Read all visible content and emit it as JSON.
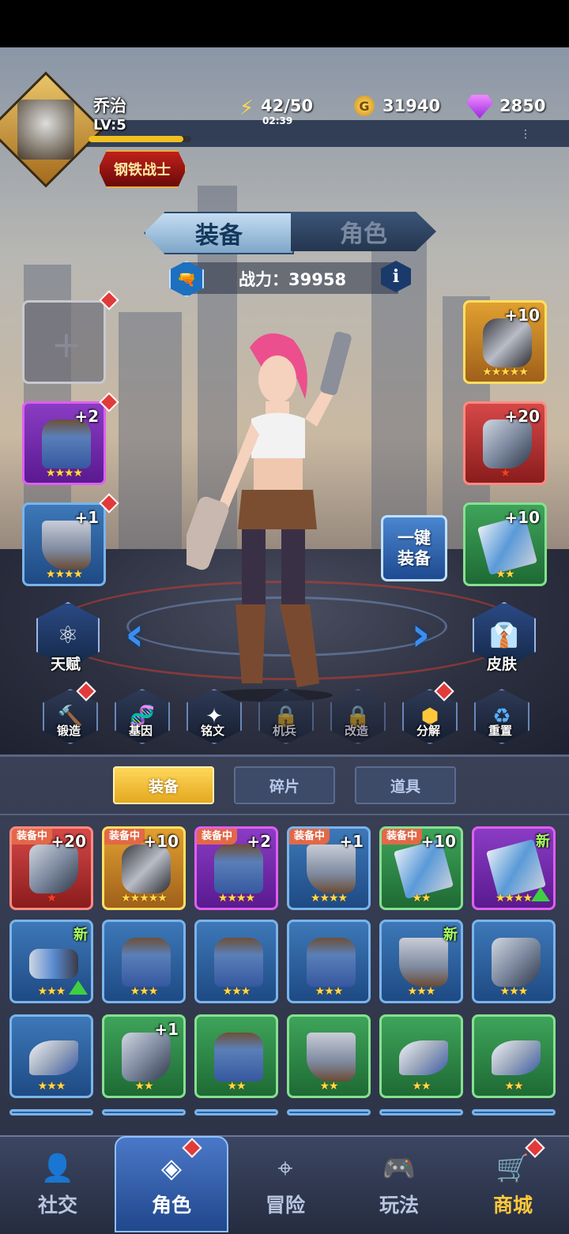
{
  "player": {
    "name": "乔治",
    "level": "LV:5",
    "rank_badge": "钢铁战士"
  },
  "resources": {
    "energy": "42/50",
    "energy_timer": "02:39",
    "gold": "31940",
    "gems": "2850"
  },
  "top_tabs": [
    {
      "label": "装备",
      "active": true
    },
    {
      "label": "角色",
      "active": false
    }
  ],
  "power": {
    "label": "战力：39958"
  },
  "equip_slots": {
    "left": [
      {
        "level": "",
        "stars": "",
        "rarity": "empty"
      },
      {
        "level": "+2",
        "stars": "★★★★",
        "rarity": "purple"
      },
      {
        "level": "+1",
        "stars": "★★★★",
        "rarity": "blue"
      }
    ],
    "right": [
      {
        "level": "+10",
        "stars": "★★★★★",
        "rarity": "gold"
      },
      {
        "level": "+20",
        "stars": "★",
        "rarity": "red"
      },
      {
        "level": "+10",
        "stars": "★★",
        "rarity": "green"
      }
    ]
  },
  "one_click_equip": {
    "line1": "一键",
    "line2": "装备"
  },
  "side_buttons": {
    "talent": "天赋",
    "skin": "皮肤"
  },
  "function_buttons": [
    {
      "label": "锻造",
      "icon": "hammer-icon",
      "locked": false
    },
    {
      "label": "基因",
      "icon": "dna-icon",
      "locked": false
    },
    {
      "label": "铭文",
      "icon": "rune-icon",
      "locked": false
    },
    {
      "label": "机兵",
      "icon": "lock-icon",
      "locked": true
    },
    {
      "label": "改造",
      "icon": "lock-icon",
      "locked": true
    },
    {
      "label": "分解",
      "icon": "hexagons-icon",
      "locked": false
    },
    {
      "label": "重置",
      "icon": "recycle-icon",
      "locked": false
    }
  ],
  "inventory_tabs": [
    {
      "label": "装备",
      "active": true
    },
    {
      "label": "碎片",
      "active": false
    },
    {
      "label": "道具",
      "active": false
    }
  ],
  "inventory": [
    [
      {
        "tag": "装备中",
        "level": "+20",
        "stars": "★",
        "rarity": "red",
        "kind": "gauntlet"
      },
      {
        "tag": "装备中",
        "level": "+10",
        "stars": "★★★★★",
        "rarity": "gold",
        "kind": "beast"
      },
      {
        "tag": "装备中",
        "level": "+2",
        "stars": "★★★★",
        "rarity": "purple",
        "kind": "armor"
      },
      {
        "tag": "装备中",
        "level": "+1",
        "stars": "★★★★",
        "rarity": "blue",
        "kind": "boot"
      },
      {
        "tag": "装备中",
        "level": "+10",
        "stars": "★★",
        "rarity": "green",
        "kind": "card"
      },
      {
        "tag": "",
        "level": "",
        "new": "新",
        "stars": "★★★★",
        "rarity": "purple",
        "kind": "card",
        "upgrade": true
      }
    ],
    [
      {
        "tag": "",
        "level": "",
        "new": "新",
        "stars": "★★★",
        "rarity": "blue",
        "kind": "gun",
        "upgrade": true
      },
      {
        "tag": "",
        "level": "",
        "stars": "★★★",
        "rarity": "blue",
        "kind": "armor"
      },
      {
        "tag": "",
        "level": "",
        "stars": "★★★",
        "rarity": "blue",
        "kind": "armor"
      },
      {
        "tag": "",
        "level": "",
        "stars": "★★★",
        "rarity": "blue",
        "kind": "armor"
      },
      {
        "tag": "",
        "level": "",
        "new": "新",
        "stars": "★★★",
        "rarity": "blue",
        "kind": "boot"
      },
      {
        "tag": "",
        "level": "",
        "stars": "★★★",
        "rarity": "blue",
        "kind": "gauntlet"
      }
    ],
    [
      {
        "tag": "",
        "level": "",
        "stars": "★★★",
        "rarity": "blue",
        "kind": "ship"
      },
      {
        "tag": "",
        "level": "+1",
        "stars": "★★",
        "rarity": "green",
        "kind": "gauntlet"
      },
      {
        "tag": "",
        "level": "",
        "stars": "★★",
        "rarity": "green",
        "kind": "armor"
      },
      {
        "tag": "",
        "level": "",
        "stars": "★★",
        "rarity": "green",
        "kind": "boot"
      },
      {
        "tag": "",
        "level": "",
        "stars": "★★",
        "rarity": "green",
        "kind": "ship"
      },
      {
        "tag": "",
        "level": "",
        "stars": "★★",
        "rarity": "green",
        "kind": "ship"
      }
    ]
  ],
  "bottom_nav": [
    {
      "label": "社交",
      "icon": "social-icon",
      "active": false
    },
    {
      "label": "角色",
      "icon": "character-icon",
      "active": true
    },
    {
      "label": "冒险",
      "icon": "map-pin-icon",
      "active": false
    },
    {
      "label": "玩法",
      "icon": "gamepad-icon",
      "active": false
    },
    {
      "label": "商城",
      "icon": "shopping-cart-icon",
      "active": false
    }
  ],
  "colors": {
    "accent_gold": "#f0c020",
    "tab_active": "#ffd75a",
    "notification": "#e23a3a"
  }
}
